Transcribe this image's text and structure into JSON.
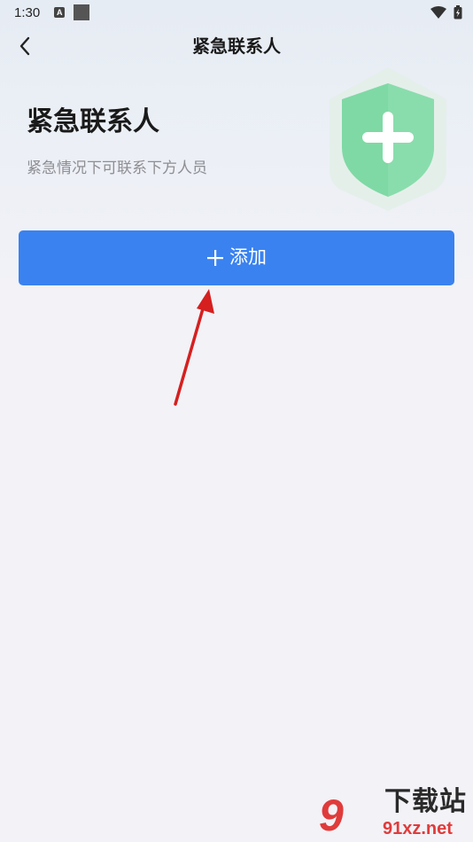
{
  "status_bar": {
    "time": "1:30",
    "notification_badge": "A",
    "icons": [
      "wifi-icon",
      "battery-icon"
    ]
  },
  "header": {
    "back_icon": "chevron-left-icon",
    "title": "紧急联系人"
  },
  "hero": {
    "title": "紧急联系人",
    "subtitle": "紧急情况下可联系下方人员",
    "illustration_icon": "shield-plus-icon"
  },
  "actions": {
    "add_label": "添加",
    "add_icon": "plus-icon"
  },
  "watermark": {
    "glyph": "9",
    "title": "下载站",
    "domain": "91xz.net"
  },
  "colors": {
    "primary": "#3a82f0",
    "shield_green": "#7fd9a5",
    "annotation_red": "#d61f1f",
    "background": "#f2f2f7"
  }
}
